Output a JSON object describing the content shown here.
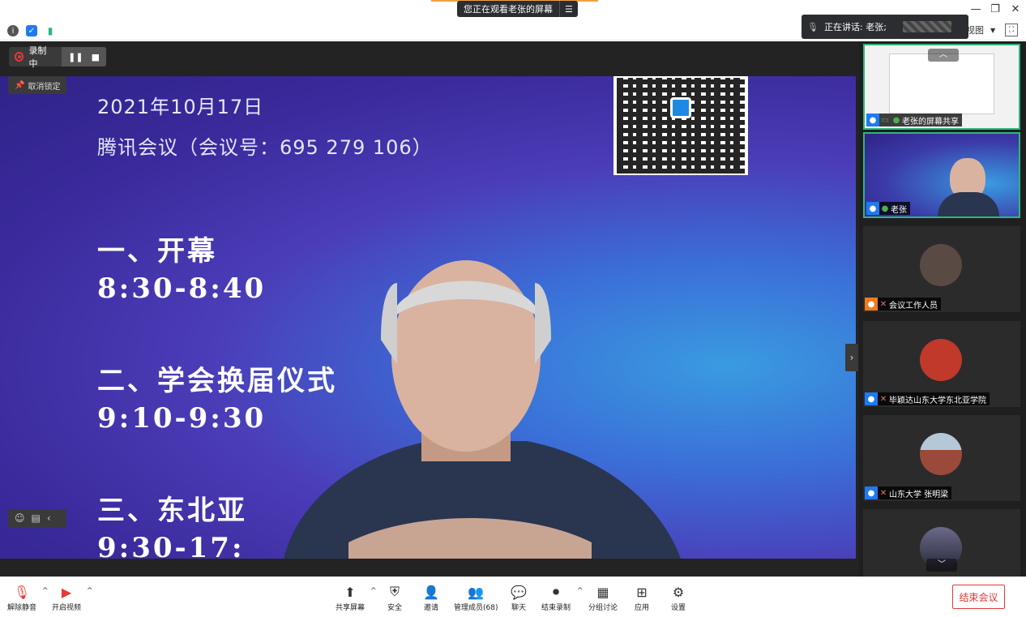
{
  "window": {
    "share_banner": "您正在观看老张的屏幕",
    "share_menu_icon": "menu-icon",
    "controls": [
      "minimize-icon",
      "restore-icon",
      "close-icon"
    ]
  },
  "info_bar": {
    "icons": [
      "info-icon",
      "shield-icon",
      "signal-icon"
    ],
    "speaker_label": "正在讲话: 老张;",
    "view_label": "视图",
    "fullscreen_icon": "fullscreen-icon"
  },
  "recording": {
    "status": "录制中",
    "pause_icon": "pause-icon",
    "stop_icon": "stop-icon"
  },
  "unpin_label": "取消锁定",
  "slide": {
    "date": "2021年10月17日",
    "meeting": "腾讯会议（会议号：695 279 106）",
    "agenda": [
      {
        "title": "一、开幕",
        "time": "8:30-8:40"
      },
      {
        "title": "二、学会换届仪式",
        "time": "9:10-9:30"
      },
      {
        "title": "三、东北亚",
        "time": "9:30-17:"
      }
    ]
  },
  "participants": [
    {
      "name": "老张的屏幕共享",
      "type": "screen-share",
      "mic": "on"
    },
    {
      "name": "老张",
      "type": "video",
      "mic": "on",
      "active": true
    },
    {
      "name": "会议工作人员",
      "type": "avatar",
      "mic": "muted",
      "badge": "orange"
    },
    {
      "name": "毕颖达山东大学东北亚学院",
      "type": "avatar",
      "mic": "muted"
    },
    {
      "name": "山东大学 张明梁",
      "type": "avatar",
      "mic": "muted"
    },
    {
      "name": "",
      "type": "avatar",
      "mic": "muted"
    }
  ],
  "toolbar": {
    "unmute": "解除静音",
    "start_video": "开启视频",
    "share_screen": "共享屏幕",
    "security": "安全",
    "invite": "邀请",
    "manage_members": "管理成员(68)",
    "chat": "聊天",
    "end_record": "结束录制",
    "breakout": "分组讨论",
    "apps": "应用",
    "settings": "设置",
    "end_meeting": "结束会议"
  },
  "colors": {
    "accent_green": "#2eb67d",
    "end_red": "#e53935",
    "user_blue": "#1e7bf0",
    "staff_orange": "#f07a1e"
  }
}
